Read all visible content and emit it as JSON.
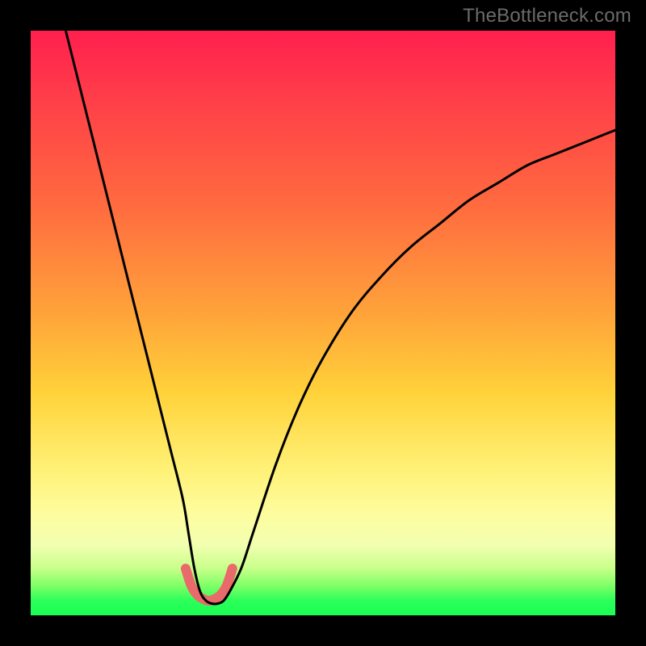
{
  "watermark": "TheBottleneck.com",
  "chart_data": {
    "type": "line",
    "title": "",
    "xlabel": "",
    "ylabel": "",
    "xlim": [
      0,
      100
    ],
    "ylim": [
      0,
      100
    ],
    "series": [
      {
        "name": "bottleneck-curve",
        "x": [
          6,
          8,
          10,
          12,
          14,
          16,
          18,
          20,
          22,
          24,
          26,
          27,
          28,
          29,
          30,
          31,
          32,
          33,
          34,
          36,
          38,
          42,
          46,
          50,
          55,
          60,
          65,
          70,
          75,
          80,
          85,
          90,
          95,
          100
        ],
        "values": [
          100,
          92,
          84,
          76,
          68,
          60,
          52,
          44,
          36,
          28,
          20,
          14,
          8,
          4,
          2.5,
          2,
          2,
          2.5,
          4,
          8,
          14,
          26,
          36,
          44,
          52,
          58,
          63,
          67,
          71,
          74,
          77,
          79,
          81,
          83
        ]
      },
      {
        "name": "confidence-band",
        "x": [
          26.5,
          27.5,
          28.5,
          29.5,
          30.5,
          31.5,
          32.5,
          33.5,
          34.5
        ],
        "values": [
          8,
          5,
          3.5,
          2.8,
          2.5,
          2.8,
          3.5,
          5,
          8
        ]
      }
    ]
  },
  "colors": {
    "curve": "#000000",
    "band": "#e96a6a",
    "background_top": "#ff1f4e",
    "background_bottom": "#1aff55"
  }
}
